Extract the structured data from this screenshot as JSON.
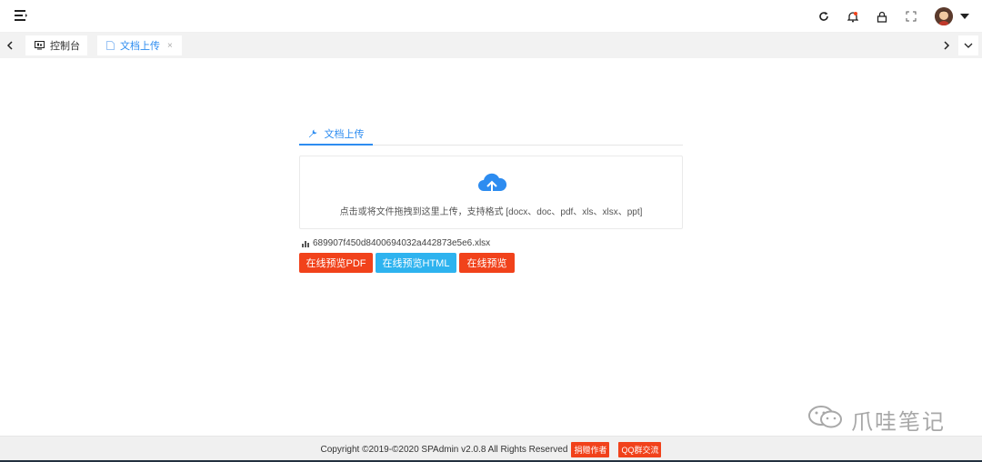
{
  "header": {
    "icons": [
      "menu-icon",
      "refresh-icon",
      "notification-icon",
      "lock-icon",
      "fullscreen-icon"
    ],
    "avatar_icon": "user-avatar"
  },
  "tabs": [
    {
      "label": "控制台",
      "icon": "monitor-icon",
      "active": false
    },
    {
      "label": "文档上传",
      "icon": "document-icon",
      "active": true,
      "close": "×"
    }
  ],
  "panel": {
    "tab_label": "文档上传",
    "tab_icon": "wrench-icon"
  },
  "upload": {
    "icon": "cloud-upload-icon",
    "hint": "点击或将文件拖拽到这里上传，支持格式 [docx、doc、pdf、xls、xlsx、ppt]"
  },
  "file": {
    "icon": "bar-chart-icon",
    "name": "689907f450d8400694032a442873e5e6.xlsx"
  },
  "buttons": {
    "preview_pdf": "在线预览PDF",
    "preview_html": "在线预览HTML",
    "preview": "在线预览"
  },
  "watermark": {
    "text": "爪哇笔记",
    "icon": "wechat-icon"
  },
  "footer": {
    "copyright": "Copyright ©2019-©2020 SPAdmin v2.0.8 All Rights Reserved",
    "donate": "捐赠作者",
    "qq_group": "QQ群交流"
  },
  "colors": {
    "accent": "#2d8cf0",
    "danger": "#f1421b",
    "info": "#2eb3ef"
  }
}
